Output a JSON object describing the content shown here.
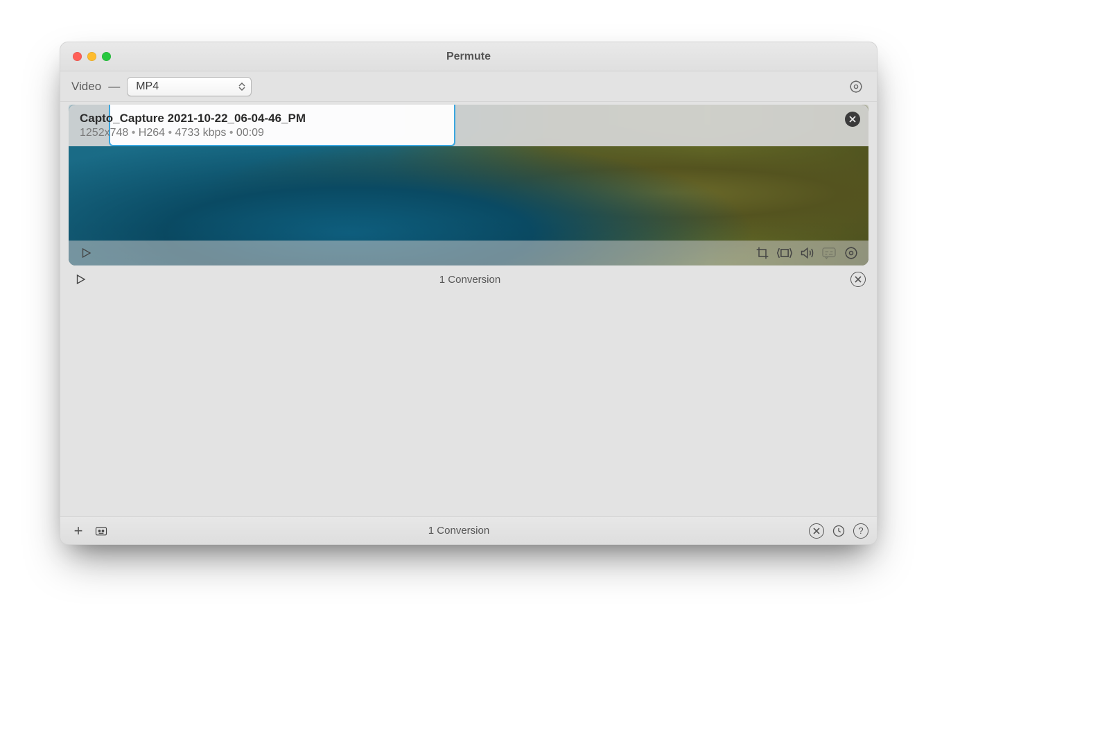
{
  "window": {
    "title": "Permute"
  },
  "toolbar": {
    "category": "Video",
    "format_selected": "MP4"
  },
  "item": {
    "filename": "Capto_Capture 2021-10-22_06-04-46_PM",
    "resolution": "1252x748",
    "codec": "H264",
    "bitrate": "4733 kbps",
    "duration": "00:09"
  },
  "section": {
    "count_text": "1 Conversion"
  },
  "footer": {
    "count_text": "1 Conversion"
  }
}
